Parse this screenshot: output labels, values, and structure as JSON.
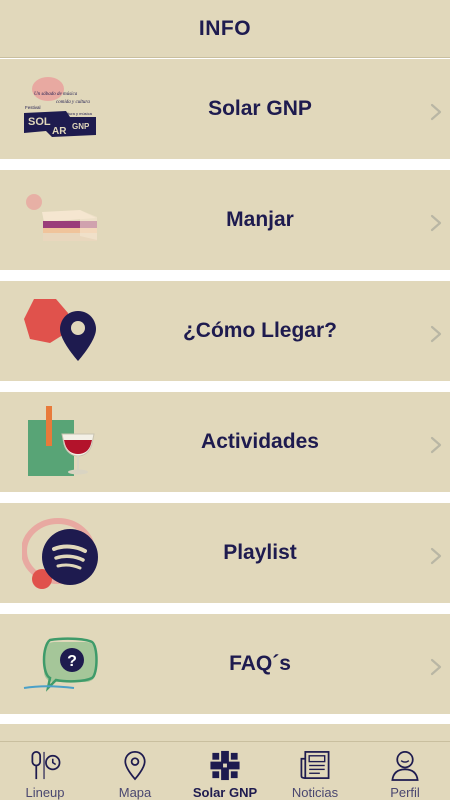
{
  "header": {
    "title": "INFO"
  },
  "rows": [
    {
      "label": "Solar GNP",
      "icon": "solar-gnp-logo-icon"
    },
    {
      "label": "Manjar",
      "icon": "sandwich-icon"
    },
    {
      "label": "¿Cómo Llegar?",
      "icon": "map-pin-icon"
    },
    {
      "label": "Actividades",
      "icon": "wine-glass-icon"
    },
    {
      "label": "Playlist",
      "icon": "spotify-icon"
    },
    {
      "label": "FAQ´s",
      "icon": "question-bubble-icon"
    }
  ],
  "logo_text": {
    "line1": "Un sábado de música",
    "line2": "comida y cultura",
    "badge1": "Festival",
    "badge2": "Cultura y música",
    "word1": "SOL",
    "word2": "AR",
    "word3": "GNP"
  },
  "faq_glyph": "?",
  "tabs": [
    {
      "label": "Lineup",
      "icon": "lineup-icon",
      "active": false
    },
    {
      "label": "Mapa",
      "icon": "map-location-icon",
      "active": false
    },
    {
      "label": "Solar GNP",
      "icon": "solar-logo-icon",
      "active": true
    },
    {
      "label": "Noticias",
      "icon": "newspaper-icon",
      "active": false
    },
    {
      "label": "Perfil",
      "icon": "profile-icon",
      "active": false
    }
  ],
  "colors": {
    "background": "#e1d8bb",
    "text": "#1e1b4f",
    "accent_red": "#e0524c",
    "accent_green": "#3f9b6a",
    "accent_pink": "#e8a9a1"
  }
}
